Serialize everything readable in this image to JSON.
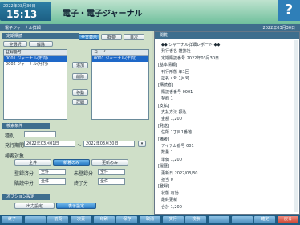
{
  "header": {
    "date": "2022年03月30日",
    "time": "15:13",
    "title": "電子・電子ジャーナル",
    "help_glyph": "?"
  },
  "subbar": {
    "left": "電子ジャーナル詳細",
    "right": "2022年03月30日"
  },
  "left_panel": {
    "title": "定期購読",
    "toggle_all": "全選択",
    "toggle_clear": "解除",
    "list_left": {
      "header": "登録番号",
      "rows": [
        "0001 ジャーナル(年間)",
        "0002 ジャーナル(月刊)"
      ],
      "selected_index": 0
    },
    "mid_buttons": [
      "追加",
      "削除",
      "移動",
      "詳細"
    ],
    "top_tabs": [
      "全文表示",
      "概要",
      "目次"
    ],
    "list_right": {
      "header": "コード",
      "rows": [
        "0001 ジャーナル(年間)"
      ]
    }
  },
  "search_panel": {
    "title": "検索条件",
    "label_kind": "種別",
    "label_period": "発行期間",
    "date_from": "2022年03月01日",
    "date_to": "2022年03月30日",
    "label_target": "検索対象",
    "target_opts": [
      "全件",
      "新着のみ",
      "更新のみ"
    ],
    "check_labels": [
      "登録済分",
      "未登録分",
      "購読中分",
      "終了分"
    ],
    "check_vals": [
      "全件",
      "全件",
      "全件",
      "全件"
    ]
  },
  "extra_panel": {
    "title": "オプション設定",
    "opt_a": "出力設定",
    "opt_b": "表示設定"
  },
  "right_panel": {
    "title": "閲覧",
    "lines": [
      "◆◆ ジャーナル詳細レポート ◆◆",
      "発行者名    雑誌社",
      "定期購読番号       2022年03月30日",
      "[基本情報]",
      "刊行形態   年1回",
      "誌名・号  1月号",
      "[購読者]",
      "購読者番号        0001",
      "契約    1",
      "[支払]",
      "支払方法   振込",
      "金額     1,200",
      "[発送]",
      "住所   1丁目1番地",
      "[備考]",
      "アイテム番号     001",
      "数量       1",
      "単価     1,200",
      "[履歴]",
      "更新日   2022/03/30",
      "担当       0",
      "[登録]",
      "状態     有効",
      "最終更新",
      "合計     1,200"
    ]
  },
  "toolbar": {
    "buttons": [
      "終了",
      "",
      "前頁",
      "次頁",
      "印刷",
      "保存",
      "取消",
      "実行",
      "検索",
      "",
      "",
      "確定",
      "戻る"
    ]
  }
}
